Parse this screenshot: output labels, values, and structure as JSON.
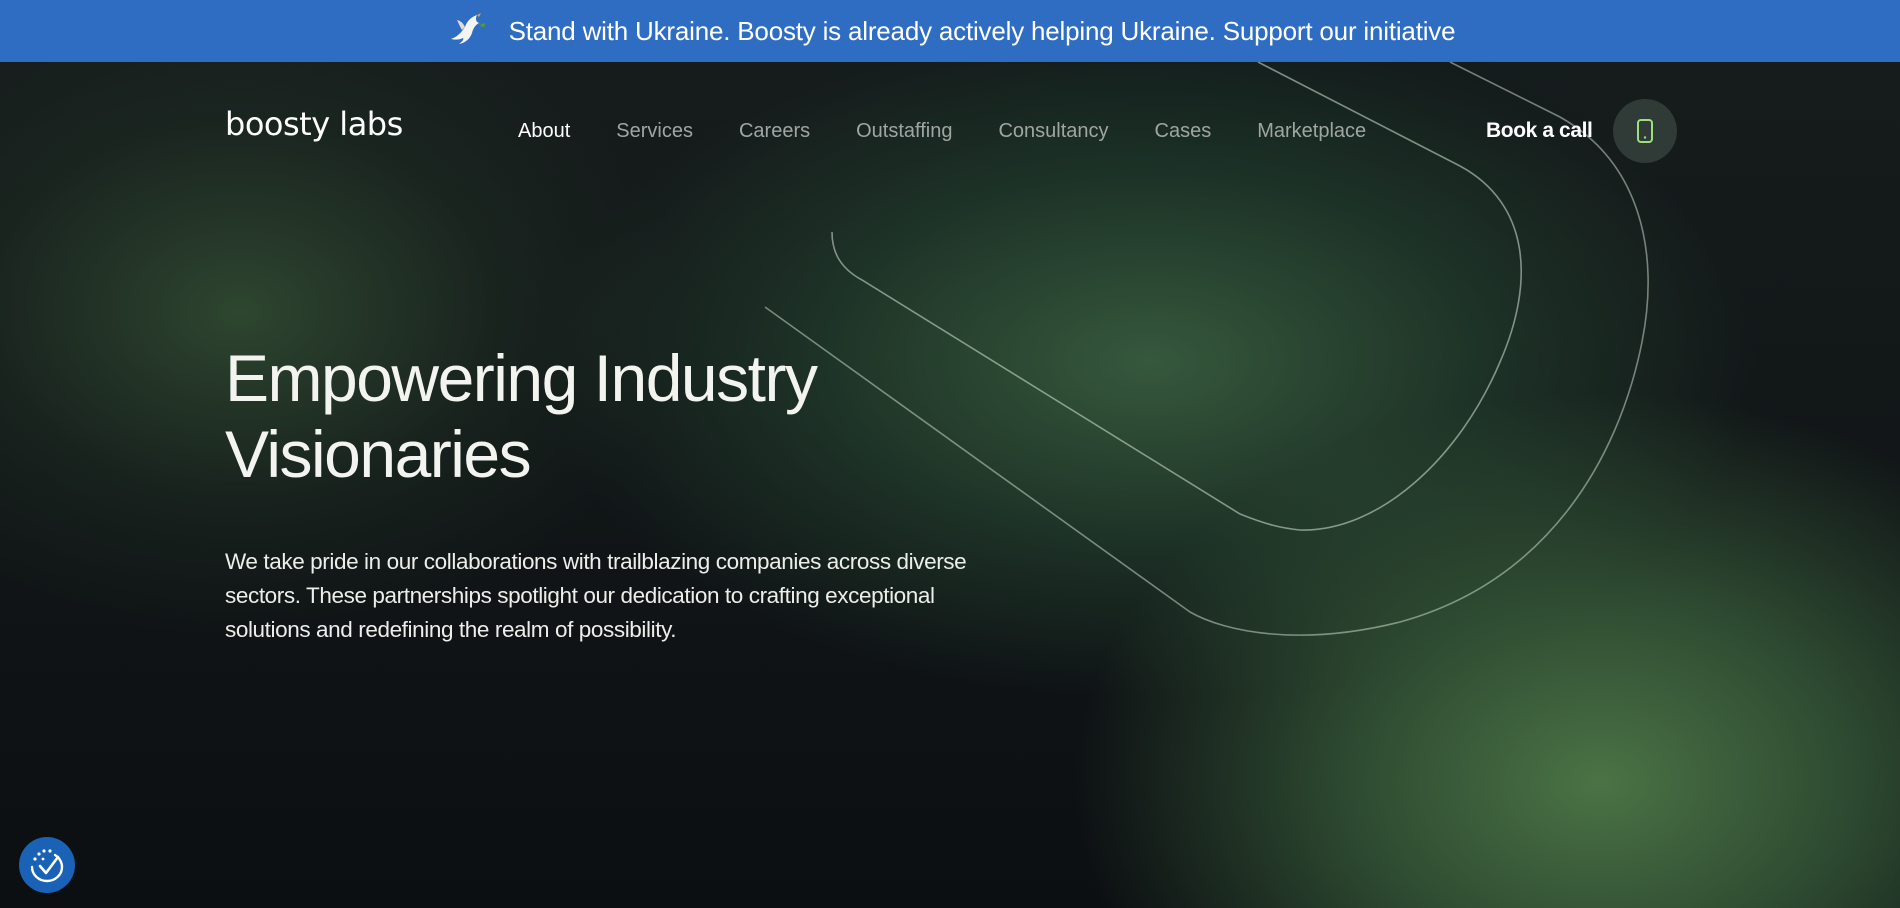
{
  "banner": {
    "text": "Stand with Ukraine. Boosty is already actively helping Ukraine. Support our initiative",
    "icon": "dove-icon",
    "background": "#2f6dc2"
  },
  "header": {
    "logo": "boosty labs",
    "nav": [
      {
        "label": "About",
        "active": true
      },
      {
        "label": "Services",
        "active": false
      },
      {
        "label": "Careers",
        "active": false
      },
      {
        "label": "Outstaffing",
        "active": false
      },
      {
        "label": "Consultancy",
        "active": false
      },
      {
        "label": "Cases",
        "active": false
      },
      {
        "label": "Marketplace",
        "active": false
      }
    ],
    "cta_label": "Book a call",
    "phone_icon": "phone-icon",
    "accent": "#9be07a"
  },
  "hero": {
    "headline_line1": "Empowering Industry",
    "headline_line2": "Visionaries",
    "description": "We take pride in our collaborations with trailblazing companies across diverse sectors. These partnerships spotlight our dedication to crafting exceptional solutions and redefining the realm of possibility."
  },
  "accessibility": {
    "icon": "accessibility-icon",
    "color": "#1a62b6"
  }
}
